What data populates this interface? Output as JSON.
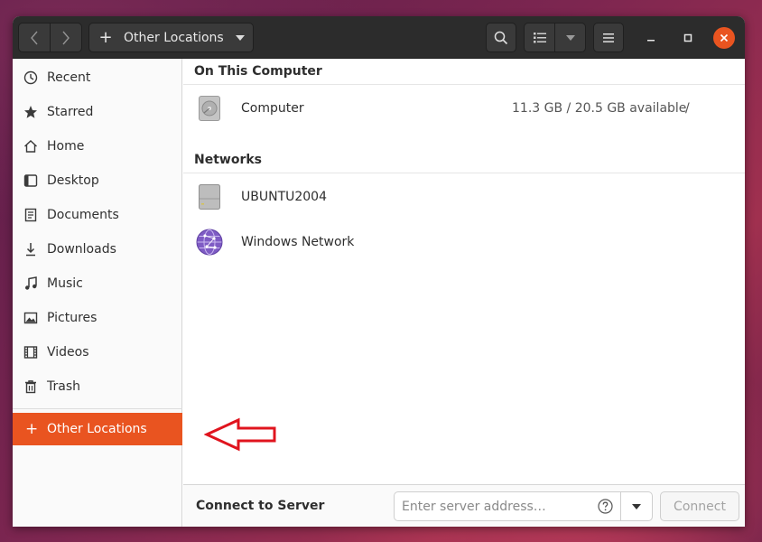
{
  "header": {
    "path_label": "Other Locations"
  },
  "sidebar": {
    "items": [
      {
        "label": "Recent",
        "icon": "clock-icon"
      },
      {
        "label": "Starred",
        "icon": "star-icon"
      },
      {
        "label": "Home",
        "icon": "home-icon"
      },
      {
        "label": "Desktop",
        "icon": "desktop-icon"
      },
      {
        "label": "Documents",
        "icon": "document-icon"
      },
      {
        "label": "Downloads",
        "icon": "download-icon"
      },
      {
        "label": "Music",
        "icon": "music-note-icon"
      },
      {
        "label": "Pictures",
        "icon": "picture-icon"
      },
      {
        "label": "Videos",
        "icon": "film-icon"
      },
      {
        "label": "Trash",
        "icon": "trash-icon"
      }
    ],
    "other_locations": "Other Locations"
  },
  "main": {
    "on_this_computer": {
      "heading": "On This Computer",
      "items": [
        {
          "name": "Computer",
          "size": "11.3 GB / 20.5 GB available",
          "mount": "/",
          "icon": "hard-disk-icon"
        }
      ]
    },
    "networks": {
      "heading": "Networks",
      "items": [
        {
          "name": "UBUNTU2004",
          "icon": "network-server-icon"
        },
        {
          "name": "Windows Network",
          "icon": "network-globe-icon"
        }
      ]
    }
  },
  "connect": {
    "label": "Connect to Server",
    "placeholder": "Enter server address…",
    "value": "",
    "button": "Connect"
  },
  "colors": {
    "accent": "#e95420",
    "headerbar": "#2c2c2c",
    "annotation": "#e0141e"
  }
}
